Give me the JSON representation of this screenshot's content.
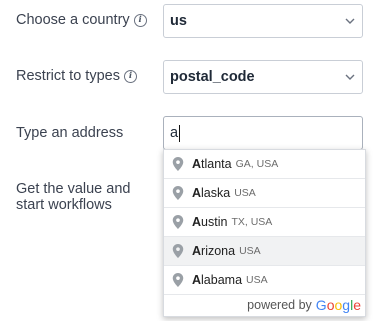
{
  "form": {
    "country": {
      "label": "Choose a country",
      "value": "us"
    },
    "types": {
      "label": "Restrict to types",
      "value": "postal_code"
    },
    "address": {
      "label": "Type an address",
      "value": "a"
    },
    "workflow": {
      "label_line1": "Get the value and",
      "label_line2": "start workflows"
    }
  },
  "suggestions": [
    {
      "match": "A",
      "rest": "tlanta",
      "secondary": "GA, USA"
    },
    {
      "match": "A",
      "rest": "laska",
      "secondary": "USA"
    },
    {
      "match": "A",
      "rest": "ustin",
      "secondary": "TX, USA"
    },
    {
      "match": "A",
      "rest": "rizona",
      "secondary": "USA"
    },
    {
      "match": "A",
      "rest": "labama",
      "secondary": "USA"
    }
  ],
  "powered": {
    "text": "powered by",
    "logo_letters": [
      "G",
      "o",
      "o",
      "g",
      "l",
      "e"
    ],
    "logo_colors": [
      "#4285F4",
      "#EA4335",
      "#FBBC05",
      "#4285F4",
      "#34A853",
      "#EA4335"
    ]
  },
  "colors": {
    "pin": "#9aa0a6",
    "chevron": "#6b7280"
  }
}
